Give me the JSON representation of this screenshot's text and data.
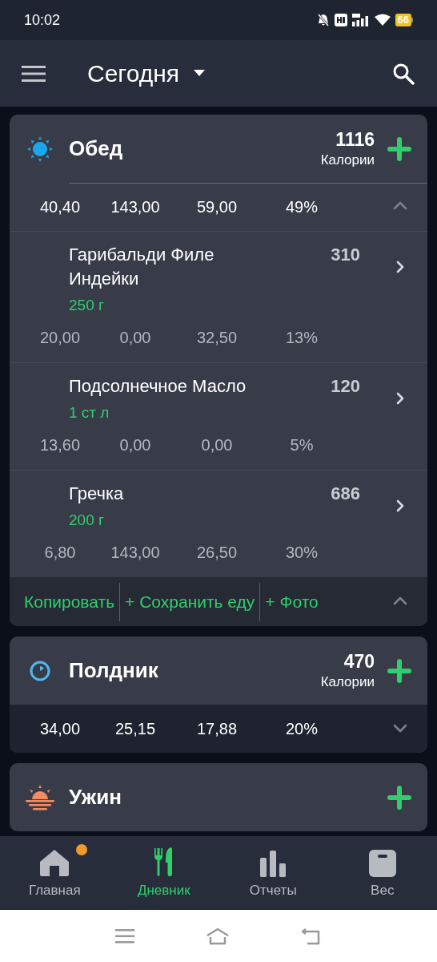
{
  "status_bar": {
    "time": "10:02",
    "battery": "66"
  },
  "app_bar": {
    "title": "Сегодня"
  },
  "meals": [
    {
      "kind": "sun",
      "name": "Обед",
      "calories": "1116",
      "calories_label": "Калории",
      "expanded": true,
      "totals": [
        "40,40",
        "143,00",
        "59,00",
        "49%"
      ],
      "items": [
        {
          "name": "Гарибальди Филе Индейки",
          "calories": "310",
          "amount": "250 г",
          "macros": [
            "20,00",
            "0,00",
            "32,50",
            "13%"
          ]
        },
        {
          "name": "Подсолнечное Масло",
          "calories": "120",
          "amount": "1 ст л",
          "macros": [
            "13,60",
            "0,00",
            "0,00",
            "5%"
          ]
        },
        {
          "name": "Гречка",
          "calories": "686",
          "amount": "200 г",
          "macros": [
            "6,80",
            "143,00",
            "26,50",
            "30%"
          ]
        }
      ],
      "actions": [
        "Копировать",
        "+ Сохранить еду",
        "+ Фото"
      ]
    },
    {
      "kind": "clock",
      "name": "Полдник",
      "calories": "470",
      "calories_label": "Калории",
      "expanded": false,
      "totals": [
        "34,00",
        "25,15",
        "17,88",
        "20%"
      ]
    },
    {
      "kind": "sunset",
      "name": "Ужин"
    }
  ],
  "tabs": [
    {
      "kind": "home",
      "label": "Главная",
      "selected": false,
      "notification": true
    },
    {
      "kind": "diary",
      "label": "Дневник",
      "selected": true,
      "notification": false
    },
    {
      "kind": "reports",
      "label": "Отчеты",
      "selected": false,
      "notification": false
    },
    {
      "kind": "weight",
      "label": "Вес",
      "selected": false,
      "notification": false
    }
  ]
}
